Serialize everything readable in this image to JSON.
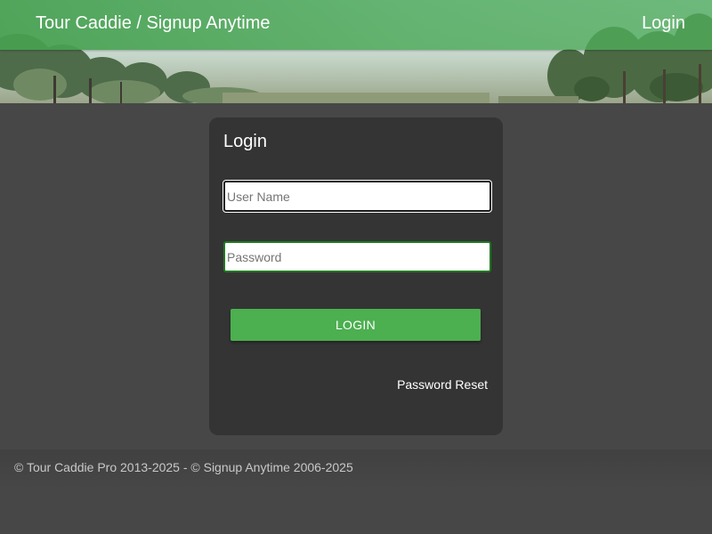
{
  "header": {
    "brand": "Tour Caddie / Signup Anytime",
    "nav_login": "Login"
  },
  "login_form": {
    "title": "Login",
    "username_placeholder": "User Name",
    "password_placeholder": "Password",
    "login_button": "LOGIN",
    "password_reset": "Password Reset"
  },
  "footer": {
    "copyright": "© Tour Caddie Pro 2013-2025 - © Signup Anytime 2006-2025"
  },
  "colors": {
    "navbar_green": "#4aa85a",
    "button_green": "#4caf50",
    "card_bg": "#343434",
    "page_bg": "#474747"
  },
  "icons": {
    "hero_image": "golf-course-trees-image"
  }
}
